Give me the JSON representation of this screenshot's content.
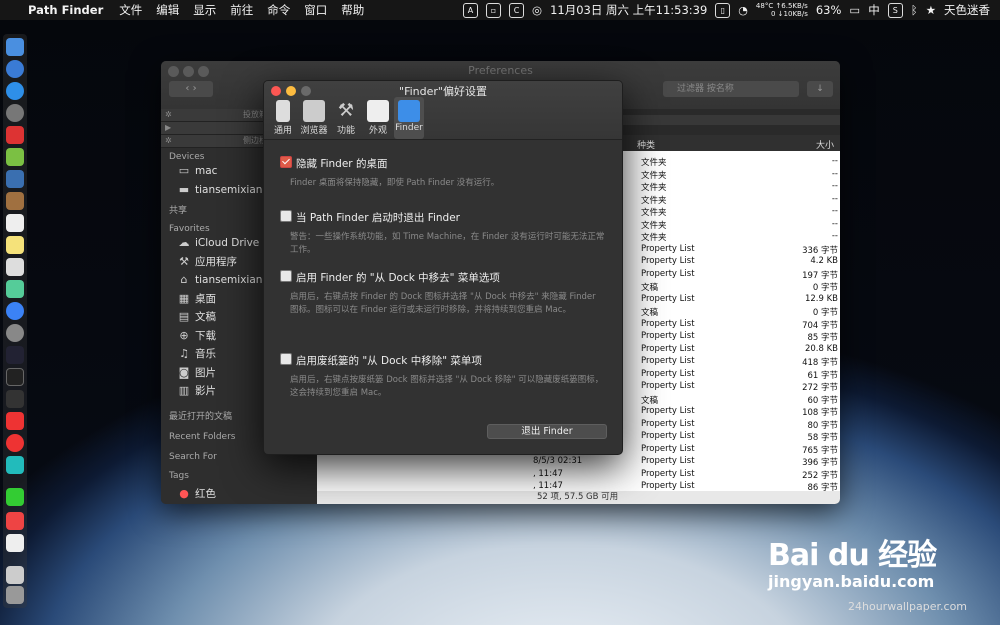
{
  "menubar": {
    "app_name": "Path Finder",
    "menus": [
      "文件",
      "编辑",
      "显示",
      "前往",
      "命令",
      "窗口",
      "帮助"
    ],
    "temp": "48°C",
    "net_up": "↑6.5KB/s",
    "net_cpu": "0",
    "net_down": "↓10KB/s",
    "clock": "11月03日 周六 上午11:53:39",
    "battery": "63%",
    "input_method": "中",
    "user": "天色迷香"
  },
  "finder": {
    "title": "Preferences",
    "search_placeholder": "过滤器 按名称",
    "sidebar_top1": "投放箱",
    "sidebar_top2": "侧边栏",
    "sections": {
      "devices": "Devices",
      "shared": "共享",
      "favorites": "Favorites",
      "recent_files": "最近打开的文稿",
      "recent_folders": "Recent Folders",
      "search_for": "Search For",
      "tags": "Tags"
    },
    "devices": [
      "mac",
      "tiansemixiang"
    ],
    "favorites": [
      "iCloud Drive",
      "应用程序",
      "tiansemixiang",
      "桌面",
      "文稿",
      "下载",
      "音乐",
      "图片",
      "影片"
    ],
    "tag_red": "红色",
    "col_kind": "种类",
    "col_size": "大小",
    "rows": [
      {
        "kind": "文件夹",
        "size": "--"
      },
      {
        "kind": "文件夹",
        "size": "--"
      },
      {
        "kind": "文件夹",
        "size": "--"
      },
      {
        "kind": "文件夹",
        "size": "--"
      },
      {
        "kind": "文件夹",
        "size": "--"
      },
      {
        "kind": "文件夹",
        "size": "--"
      },
      {
        "kind": "文件夹",
        "size": "--"
      },
      {
        "kind": "Property List",
        "size": "336 字节"
      },
      {
        "kind": "Property List",
        "size": "4.2 KB"
      },
      {
        "kind": "Property List",
        "size": "197 字节"
      },
      {
        "kind": "文稿",
        "size": "0 字节"
      },
      {
        "kind": "Property List",
        "size": "12.9 KB"
      },
      {
        "kind": "文稿",
        "size": "0 字节"
      },
      {
        "kind": "Property List",
        "size": "704 字节"
      },
      {
        "kind": "Property List",
        "size": "85 字节"
      },
      {
        "kind": "Property List",
        "size": "20.8 KB"
      },
      {
        "kind": "Property List",
        "size": "418 字节"
      },
      {
        "kind": "Property List",
        "size": "61 字节"
      },
      {
        "kind": "Property List",
        "size": "272 字节"
      },
      {
        "kind": "文稿",
        "size": "60 字节"
      },
      {
        "kind": "Property List",
        "size": "108 字节"
      },
      {
        "kind": "Property List",
        "size": "80 字节"
      },
      {
        "kind": "Property List",
        "size": "58 字节"
      },
      {
        "kind": "Property List",
        "size": "765 字节"
      },
      {
        "kind": "Property List",
        "size": "396 字节",
        "date": "8/5/3 02:31"
      },
      {
        "kind": "Property List",
        "size": "252 字节",
        "date": ", 11:47"
      },
      {
        "kind": "Property List",
        "size": "86 字节",
        "date": ", 11:47"
      }
    ],
    "status": "52 项, 57.5 GB 可用"
  },
  "prefs": {
    "title": "\"Finder\"偏好设置",
    "tabs": [
      "通用",
      "浏览器",
      "功能",
      "外观",
      "Finder"
    ],
    "options": [
      {
        "label": "隐藏 Finder 的桌面",
        "desc": "Finder 桌面将保持隐藏，即使 Path Finder 没有运行。",
        "checked": true
      },
      {
        "label": "当 Path Finder 启动时退出 Finder",
        "desc": "警告：一些操作系统功能，如 Time Machine，在 Finder 没有运行时可能无法正常工作。",
        "checked": false
      },
      {
        "label": "启用 Finder 的 \"从 Dock 中移去\" 菜单选项",
        "desc": "启用后，右键点按 Finder 的 Dock 图标并选择 \"从 Dock 中移去\" 来隐藏 Finder 图标。图标可以在 Finder 运行或未运行时移除，并将持续到您重启 Mac。",
        "checked": false
      },
      {
        "label": "启用废纸篓的 \"从 Dock 中移除\" 菜单项",
        "desc": "启用后，右键点按废纸篓 Dock 图标并选择 \"从 Dock 移除\" 可以隐藏废纸篓图标，这会持续到您重启 Mac。",
        "checked": false
      }
    ],
    "quit_label": "退出 Finder"
  },
  "watermark": {
    "brand": "Bai du 经验",
    "url": "jingyan.baidu.com",
    "credit": "24hourwallpaper.com"
  }
}
